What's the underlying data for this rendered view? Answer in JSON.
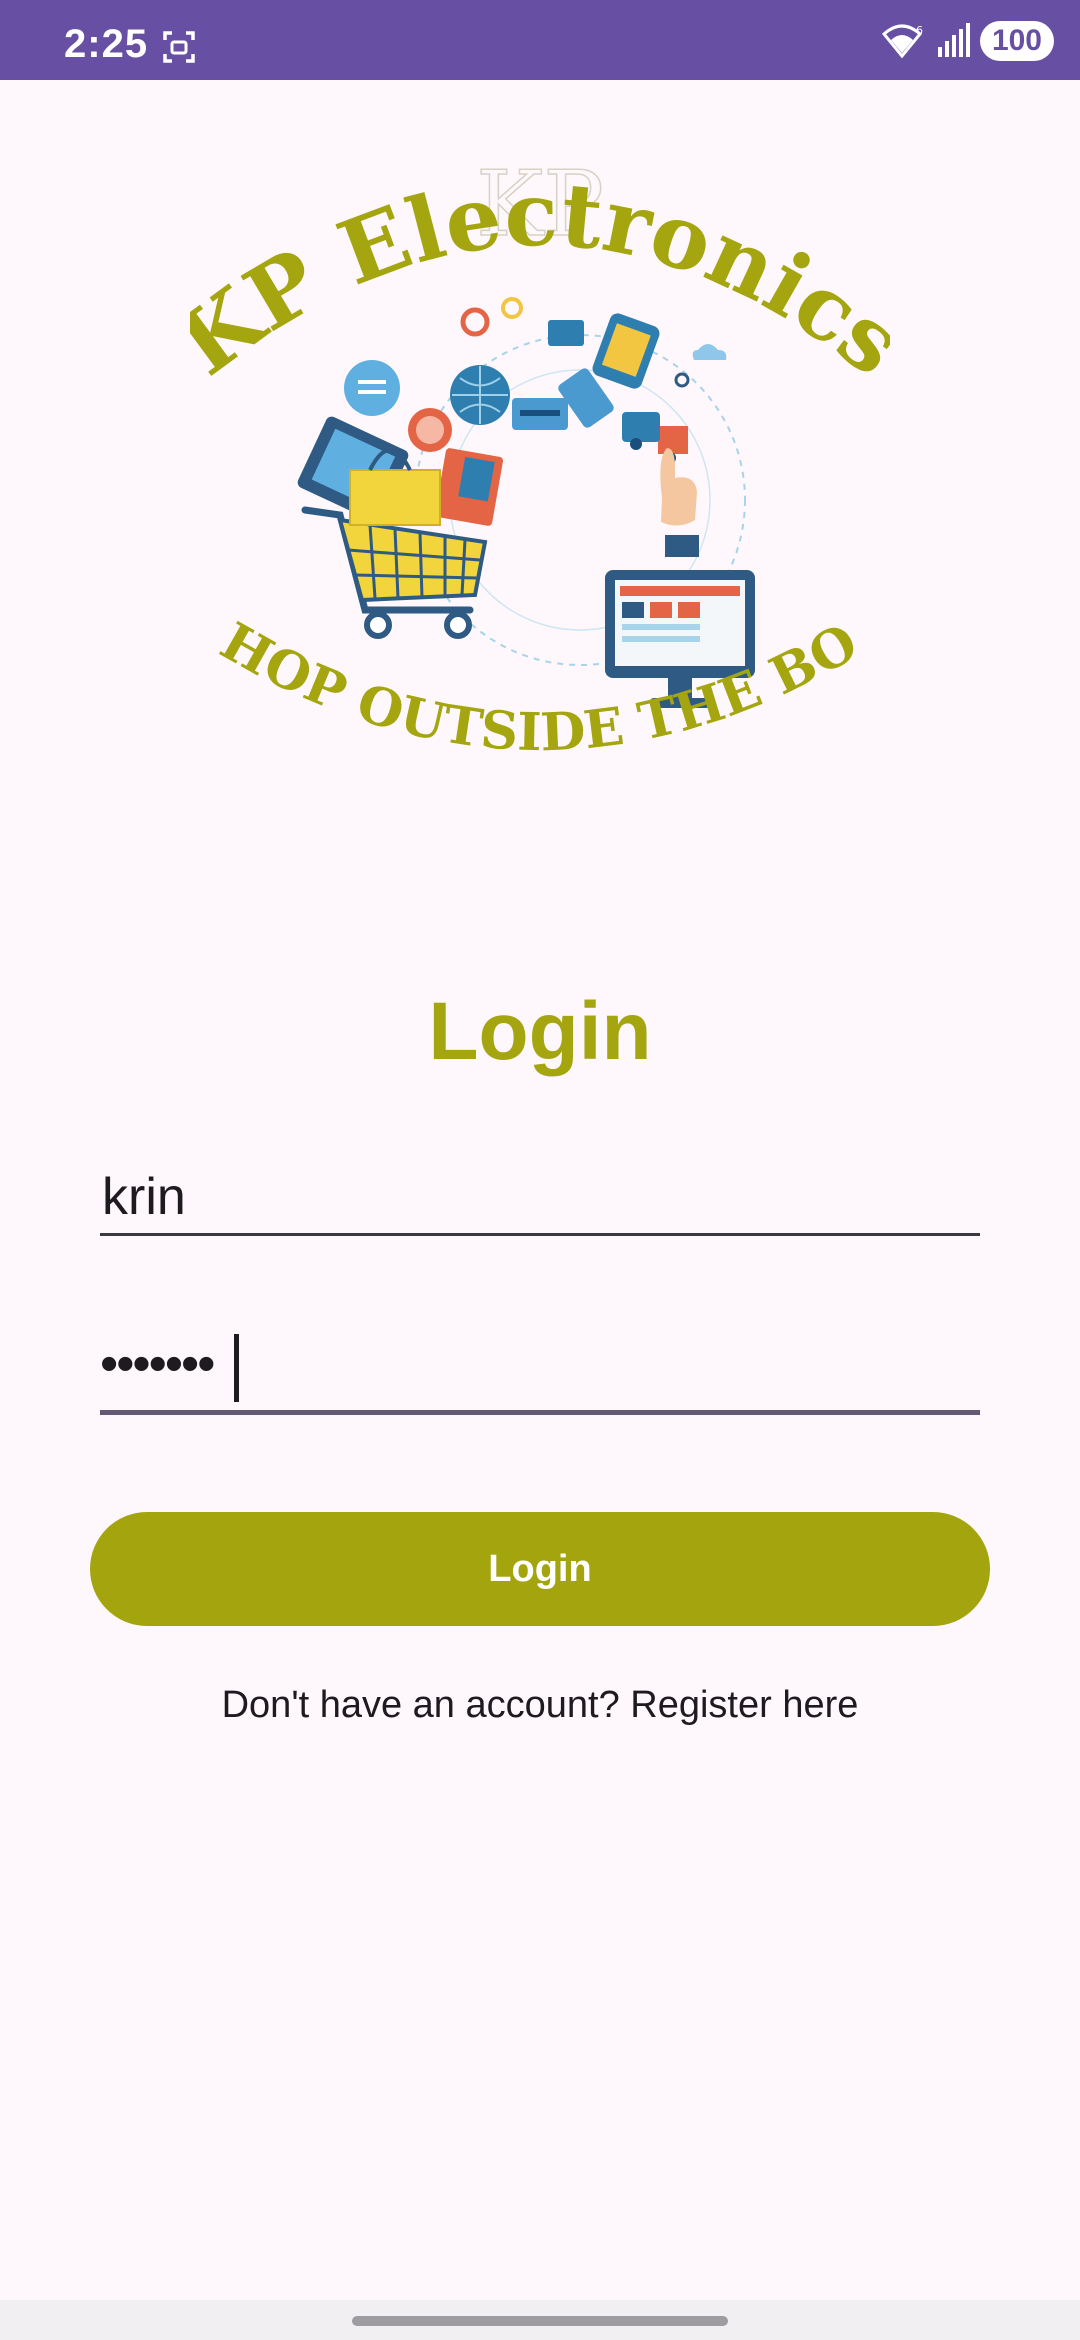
{
  "status_bar": {
    "time": "2:25",
    "battery": "100",
    "icons": [
      "screenshot-icon",
      "wifi-icon",
      "signal-icon"
    ]
  },
  "logo": {
    "title": "KP Electronics",
    "watermark": "KP",
    "tagline": "\"SHOP OUTSIDE THE BOX\"",
    "colors": {
      "brand": "#a4a50f"
    }
  },
  "login": {
    "title": "Login",
    "username_value": "krin",
    "password_mask": "•••••••",
    "button_label": "Login",
    "register_text": "Don't have an account? Register here"
  },
  "theme": {
    "accent": "#a4a50f",
    "status_bar": "#6750a4",
    "background": "#fef7fb"
  }
}
